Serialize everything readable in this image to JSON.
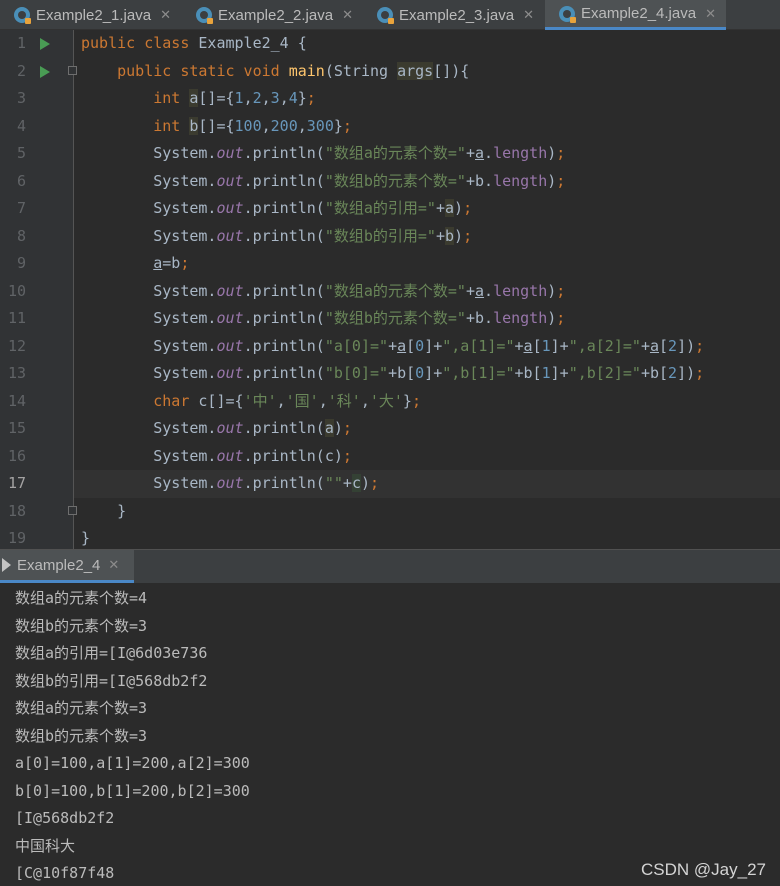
{
  "tabs": [
    {
      "label": "Example2_1.java",
      "active": false
    },
    {
      "label": "Example2_2.java",
      "active": false
    },
    {
      "label": "Example2_3.java",
      "active": false
    },
    {
      "label": "Example2_4.java",
      "active": true
    }
  ],
  "editor": {
    "line_numbers": [
      "1",
      "2",
      "3",
      "4",
      "5",
      "6",
      "7",
      "8",
      "9",
      "10",
      "11",
      "12",
      "13",
      "14",
      "15",
      "16",
      "17",
      "18",
      "19"
    ],
    "current_line": 17
  },
  "run_tab": {
    "label": "Example2_4"
  },
  "console": {
    "lines": [
      "数组a的元素个数=4",
      "数组b的元素个数=3",
      "数组a的引用=[I@6d03e736",
      "数组b的引用=[I@568db2f2",
      "数组a的元素个数=3",
      "数组b的元素个数=3",
      "a[0]=100,a[1]=200,a[2]=300",
      "b[0]=100,b[1]=200,b[2]=300",
      "[I@568db2f2",
      "中国科大",
      "[C@10f87f48"
    ]
  },
  "watermark": "CSDN @Jay_27",
  "colors": {
    "keyword": "#cc7832",
    "string": "#6a8759",
    "number": "#6897bb",
    "field": "#9876aa",
    "method": "#ffc66d",
    "accent": "#4a88c7"
  }
}
